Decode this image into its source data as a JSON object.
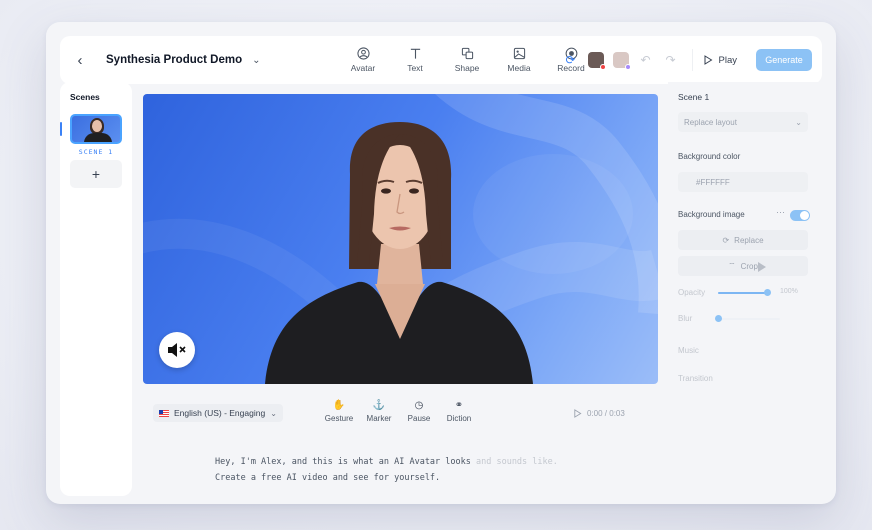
{
  "header": {
    "project_title": "Synthesia Product Demo",
    "tools": [
      {
        "label": "Avatar",
        "icon": "avatar-icon"
      },
      {
        "label": "Text",
        "icon": "text-icon"
      },
      {
        "label": "Shape",
        "icon": "shape-icon"
      },
      {
        "label": "Media",
        "icon": "media-icon"
      },
      {
        "label": "Record",
        "icon": "record-icon"
      }
    ],
    "play_label": "Play",
    "generate_label": "Generate"
  },
  "scenes": {
    "title": "Scenes",
    "items": [
      {
        "label": "SCENE 1"
      }
    ],
    "add_icon": "+"
  },
  "script": {
    "language": "English (US) - Engaging",
    "tools": [
      {
        "label": "Gesture",
        "icon": "gesture-icon"
      },
      {
        "label": "Marker",
        "icon": "marker-icon"
      },
      {
        "label": "Pause",
        "icon": "pause-icon"
      },
      {
        "label": "Diction",
        "icon": "diction-icon"
      }
    ],
    "time": "0:00 / 0:03",
    "line1_main": "Hey, I'm Alex, and this is what an AI Avatar looks",
    "line1_fade": " and sounds like.",
    "line2": "Create a free AI video and see for yourself."
  },
  "properties": {
    "scene_title": "Scene 1",
    "layout_select": "Replace layout",
    "bg_color_label": "Background color",
    "bg_color_value": "#FFFFFF",
    "bg_image_label": "Background image",
    "replace_label": "Replace",
    "crop_label": "Crop",
    "opacity_label": "Opacity",
    "opacity_value": "100%",
    "opacity_level": 0.95,
    "blur_label": "Blur",
    "blur_level": 0.0,
    "music_label": "Music",
    "transition_label": "Transition"
  },
  "colors": {
    "accent": "#3b82f6",
    "generate": "#8cc2f5"
  }
}
